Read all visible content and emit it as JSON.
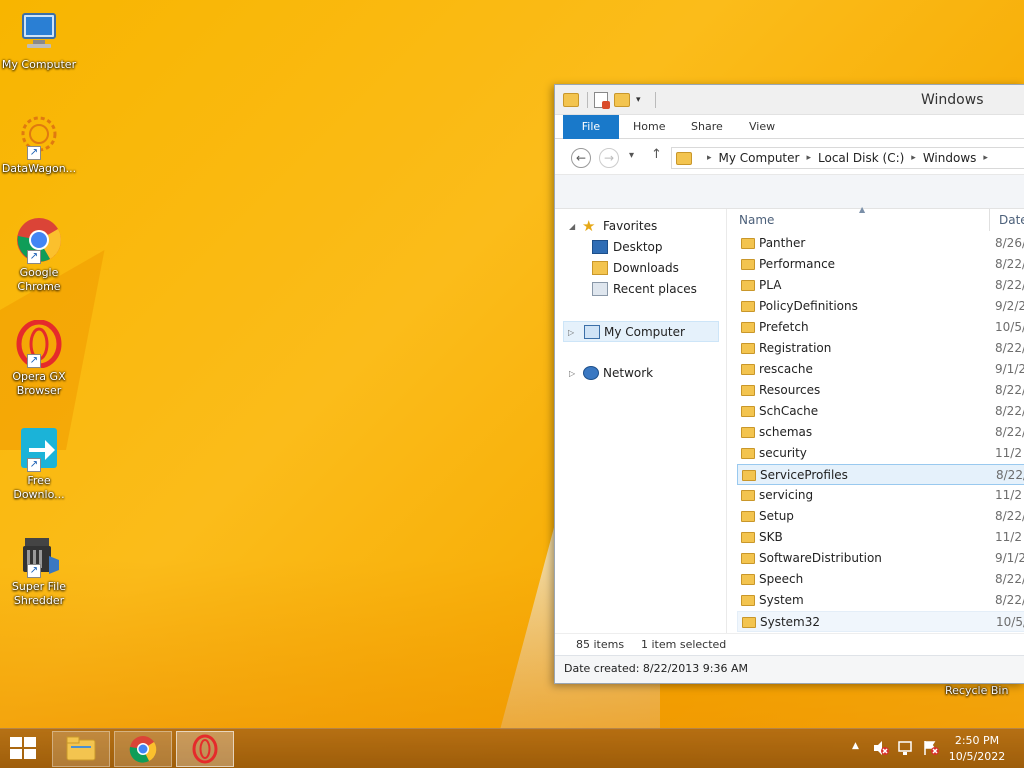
{
  "desktop": {
    "icons": [
      {
        "label": "My Computer",
        "icon": "computer-icon"
      },
      {
        "label": "DataWagon...",
        "icon": "datawagon-icon"
      },
      {
        "label": "Google Chrome",
        "icon": "chrome-icon"
      },
      {
        "label": "Opera GX Browser",
        "icon": "opera-gx-icon"
      },
      {
        "label": "Free Downlo...",
        "icon": "download-icon"
      },
      {
        "label": "Super File Shredder",
        "icon": "shredder-icon"
      }
    ],
    "recycle_bin_label": "Recycle Bin"
  },
  "explorer": {
    "title": "Windows",
    "ribbon_tabs": [
      "File",
      "Home",
      "Share",
      "View"
    ],
    "address": {
      "parts": [
        "My Computer",
        "Local Disk (C:)",
        "Windows"
      ]
    },
    "nav_pane": {
      "favorites_label": "Favorites",
      "favorites": [
        "Desktop",
        "Downloads",
        "Recent places"
      ],
      "my_computer_label": "My Computer",
      "network_label": "Network"
    },
    "columns": {
      "name": "Name",
      "date": "Date"
    },
    "files": [
      {
        "name": "Panther",
        "date": "8/26/"
      },
      {
        "name": "Performance",
        "date": "8/22/"
      },
      {
        "name": "PLA",
        "date": "8/22/"
      },
      {
        "name": "PolicyDefinitions",
        "date": "9/2/2"
      },
      {
        "name": "Prefetch",
        "date": "10/5/"
      },
      {
        "name": "Registration",
        "date": "8/22/"
      },
      {
        "name": "rescache",
        "date": "9/1/2"
      },
      {
        "name": "Resources",
        "date": "8/22/"
      },
      {
        "name": "SchCache",
        "date": "8/22/"
      },
      {
        "name": "schemas",
        "date": "8/22/"
      },
      {
        "name": "security",
        "date": "11/2"
      },
      {
        "name": "ServiceProfiles",
        "date": "8/22/"
      },
      {
        "name": "servicing",
        "date": "11/2"
      },
      {
        "name": "Setup",
        "date": "8/22/"
      },
      {
        "name": "SKB",
        "date": "11/2"
      },
      {
        "name": "SoftwareDistribution",
        "date": "9/1/2"
      },
      {
        "name": "Speech",
        "date": "8/22/"
      },
      {
        "name": "System",
        "date": "8/22/"
      },
      {
        "name": "System32",
        "date": "10/5/"
      }
    ],
    "status": {
      "items": "85 items",
      "selected": "1 item selected"
    },
    "details": "Date created: 8/22/2013 9:36 AM"
  },
  "taskbar": {
    "clock_time": "2:50 PM",
    "clock_date": "10/5/2022"
  },
  "colors": {
    "accent": "#1979ca",
    "wallpaper": "#f8b500",
    "selection": "#e5f1fb"
  }
}
